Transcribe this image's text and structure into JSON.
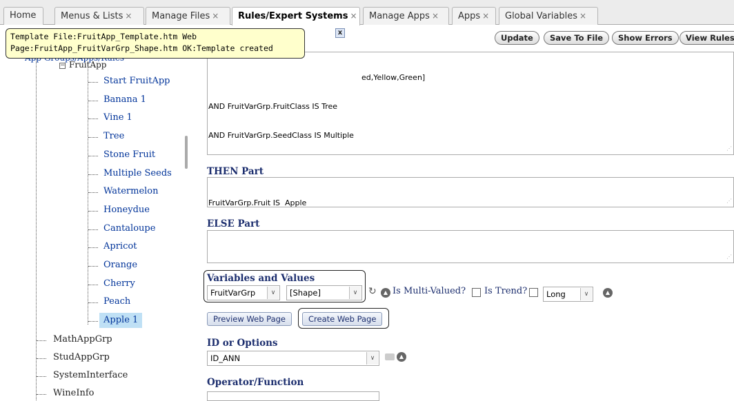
{
  "tabs": [
    {
      "label": "Home",
      "closable": false
    },
    {
      "label": "Menus & Lists",
      "closable": true
    },
    {
      "label": "Manage Files",
      "closable": true
    },
    {
      "label": "Rules/Expert Systems",
      "closable": true,
      "active": true
    },
    {
      "label": "Manage Apps",
      "closable": true
    },
    {
      "label": "Apps",
      "closable": true
    },
    {
      "label": "Global Variables",
      "closable": true
    }
  ],
  "close_glyph": "×",
  "popup": {
    "line1": "Template File:FruitApp_Template.htm Web",
    "line2": "Page:FruitApp_FruitVarGrp_Shape.htm OK:Template created",
    "close": "x"
  },
  "tree": {
    "partial_root": "App Groups/Apps/Rules",
    "partial_app": "FruitApp",
    "rules": [
      "Start FruitApp",
      "Banana 1",
      "Vine 1",
      "Tree",
      "Stone Fruit",
      "Multiple Seeds",
      "Watermelon",
      "Honeydue",
      "Cantaloupe",
      "Apricot",
      "Orange",
      "Cherry",
      "Peach",
      "Apple 1"
    ],
    "groups": [
      "MathAppGrp",
      "StudAppGrp",
      "SystemInterface",
      "WineInfo"
    ]
  },
  "toolbar": {
    "update": "Update",
    "save_to_file": "Save To File",
    "show_errors": "Show Errors",
    "view_rules": "View Rules"
  },
  "if_part": {
    "line1_partial": "ed,Yellow,Green]",
    "line2": "AND FruitVarGrp.FruitClass IS Tree",
    "line3": "AND FruitVarGrp.SeedClass IS Multiple"
  },
  "then_part": {
    "label": "THEN Part",
    "value": "FruitVarGrp.Fruit IS  Apple"
  },
  "else_part": {
    "label": "ELSE Part",
    "value": ""
  },
  "variables": {
    "label": "Variables and Values",
    "group_select": "FruitVarGrp",
    "var_select": "[Shape]",
    "multi_valued_label": "Is Multi-Valued?",
    "is_trend_label": "Is Trend?",
    "trend_select": "Long"
  },
  "page_buttons": {
    "preview": "Preview Web Page",
    "create": "Create Web Page"
  },
  "id_options": {
    "label": "ID or Options",
    "value": "ID_ANN"
  },
  "operator": {
    "label": "Operator/Function"
  }
}
